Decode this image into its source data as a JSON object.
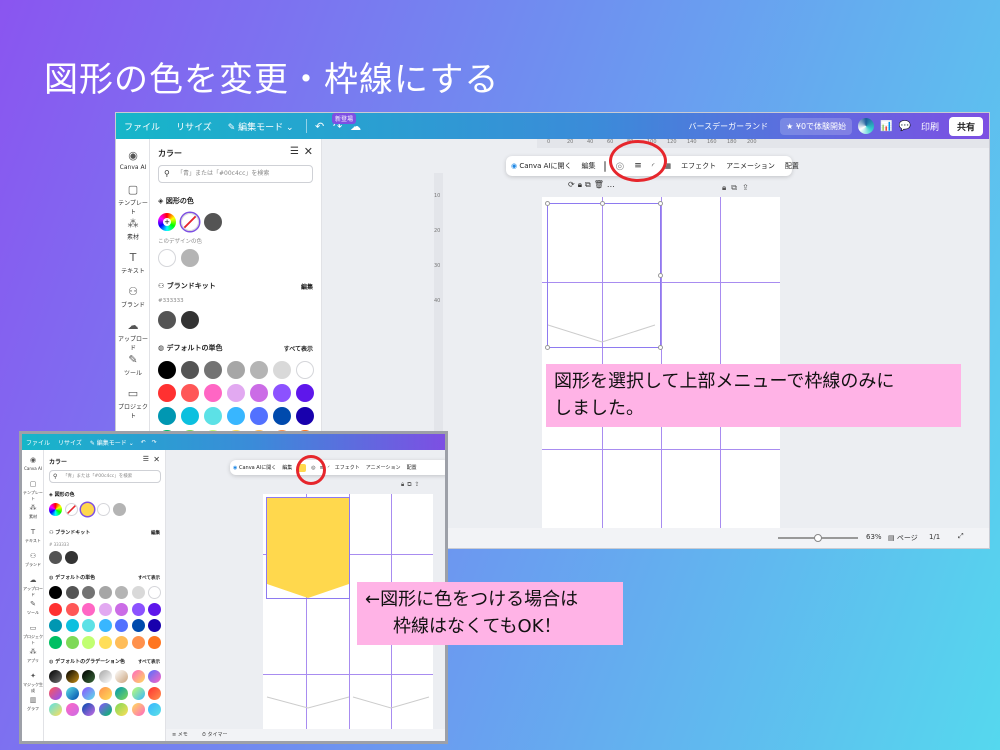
{
  "slide": {
    "title": "図形の色を変更・枠線にする"
  },
  "big": {
    "topbar": {
      "file": "ファイル",
      "resize": "リサイズ",
      "edit_mode": "編集モード",
      "new_badge": "新登場",
      "doc_title": "バースデーガーランド",
      "trial": "¥0で体験開始",
      "print": "印刷",
      "share": "共有"
    },
    "rail": [
      "Canva AI",
      "テンプレート",
      "素材",
      "テキスト",
      "ブランド",
      "アップロード",
      "ツール",
      "プロジェクト"
    ],
    "panel": {
      "title": "カラー",
      "search_placeholder": "「青」または「#00c4cc」を検索",
      "shape_color": "図形の色",
      "design_colors": "このデザインの色",
      "brand_kit": "ブランドキット",
      "edit": "編集",
      "brand_hex": "#333333",
      "default_solid": "デフォルトの単色",
      "show_all": "すべて表示"
    },
    "ctx": {
      "canva_ai": "Canva AIに開く",
      "edit": "編集",
      "effects": "エフェクト",
      "animation": "アニメーション",
      "arrange": "配置"
    },
    "ruler_top": [
      "0",
      "20",
      "40",
      "60",
      "80",
      "100",
      "120",
      "140",
      "160",
      "180",
      "200"
    ],
    "ruler_left": [
      "10",
      "20",
      "30",
      "40"
    ],
    "bottom": {
      "zoom": "63%",
      "pages": "ページ",
      "page_count": "1/1"
    }
  },
  "small": {
    "topbar": {
      "file": "ファイル",
      "resize": "リサイズ",
      "edit_mode": "編集モード"
    },
    "rail": [
      "Canva AI",
      "テンプレート",
      "素材",
      "テキスト",
      "ブランド",
      "アップロード",
      "ツール",
      "プロジェクト",
      "アプリ",
      "マジック生成",
      "グラフ"
    ],
    "panel": {
      "title": "カラー",
      "search_placeholder": "「青」または「#00c4cc」を検索",
      "shape_color": "図形の色",
      "brand_kit": "ブランドキット",
      "edit": "編集",
      "brand_hex": "# 333333",
      "default_solid": "デフォルトの単色",
      "default_gradient": "デフォルトのグラデーション色",
      "show_all": "すべて表示"
    },
    "ctx": {
      "canva_ai": "Canva AIに開く",
      "edit": "編集",
      "effects": "エフェクト",
      "animation": "アニメーション",
      "arrange": "配置"
    },
    "bottom": {
      "memo": "メモ",
      "timer": "タイマー"
    }
  },
  "callouts": {
    "outline_line1": "図形を選択して上部メニューで枠線のみに",
    "outline_line2": "しました。",
    "fill_line1": "←図形に色をつける場合は",
    "fill_line2": "枠線はなくてもOK！"
  },
  "colors": {
    "accent": "#7d4fe3",
    "highlight_red": "#e6262c",
    "callout_pink": "#ffb3e6",
    "shape_yellow": "#ffd84d",
    "solid_palette": [
      "#000000",
      "#545454",
      "#737373",
      "#a6a6a6",
      "#b4b4b4",
      "#d9d9d9",
      "#ffffff",
      "#ff3131",
      "#ff5757",
      "#ff66c4",
      "#e2a9f1",
      "#cb6ce6",
      "#8c52ff",
      "#5e17eb",
      "#0097b2",
      "#0cc0df",
      "#5ce1e6",
      "#38b6ff",
      "#5271ff",
      "#004aad",
      "#1800ad",
      "#00bf63",
      "#7ed957",
      "#c1ff72",
      "#ffde59",
      "#ffbd59",
      "#ff914d",
      "#ff751f"
    ]
  }
}
